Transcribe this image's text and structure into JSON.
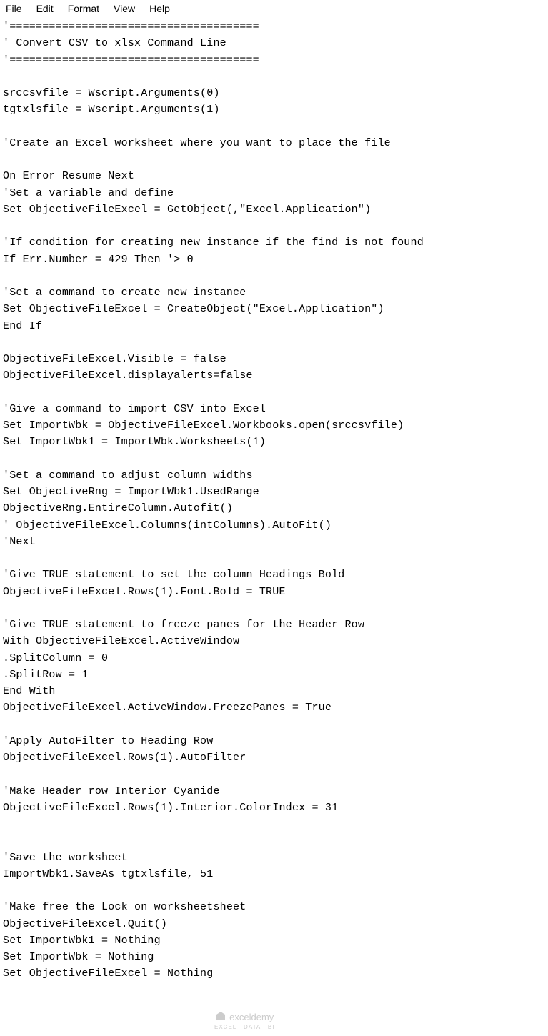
{
  "menu": {
    "file": "File",
    "edit": "Edit",
    "format": "Format",
    "view": "View",
    "help": "Help"
  },
  "code": {
    "l01": "'======================================",
    "l02": "' Convert CSV to xlsx Command Line",
    "l03": "'======================================",
    "l04": "",
    "l05": "srccsvfile = Wscript.Arguments(0)",
    "l06": "tgtxlsfile = Wscript.Arguments(1)",
    "l07": "",
    "l08": "'Create an Excel worksheet where you want to place the file",
    "l09": "",
    "l10": "On Error Resume Next",
    "l11": "'Set a variable and define",
    "l12": "Set ObjectiveFileExcel = GetObject(,\"Excel.Application\")",
    "l13": "",
    "l14": "'If condition for creating new instance if the find is not found",
    "l15": "If Err.Number = 429 Then '> 0",
    "l16": "",
    "l17": "'Set a command to create new instance",
    "l18": "Set ObjectiveFileExcel = CreateObject(\"Excel.Application\")",
    "l19": "End If",
    "l20": "",
    "l21": "ObjectiveFileExcel.Visible = false",
    "l22": "ObjectiveFileExcel.displayalerts=false",
    "l23": "",
    "l24": "'Give a command to import CSV into Excel",
    "l25": "Set ImportWbk = ObjectiveFileExcel.Workbooks.open(srccsvfile)",
    "l26": "Set ImportWbk1 = ImportWbk.Worksheets(1)",
    "l27": "",
    "l28": "'Set a command to adjust column widths",
    "l29": "Set ObjectiveRng = ImportWbk1.UsedRange",
    "l30": "ObjectiveRng.EntireColumn.Autofit()",
    "l31": "' ObjectiveFileExcel.Columns(intColumns).AutoFit()",
    "l32": "'Next",
    "l33": "",
    "l34": "'Give TRUE statement to set the column Headings Bold",
    "l35": "ObjectiveFileExcel.Rows(1).Font.Bold = TRUE",
    "l36": "",
    "l37": "'Give TRUE statement to freeze panes for the Header Row",
    "l38": "With ObjectiveFileExcel.ActiveWindow",
    "l39": ".SplitColumn = 0",
    "l40": ".SplitRow = 1",
    "l41": "End With",
    "l42": "ObjectiveFileExcel.ActiveWindow.FreezePanes = True",
    "l43": "",
    "l44": "'Apply AutoFilter to Heading Row",
    "l45": "ObjectiveFileExcel.Rows(1).AutoFilter",
    "l46": "",
    "l47": "'Make Header row Interior Cyanide",
    "l48": "ObjectiveFileExcel.Rows(1).Interior.ColorIndex = 31",
    "l49": "",
    "l50": "",
    "l51": "'Save the worksheet",
    "l52": "ImportWbk1.SaveAs tgtxlsfile, 51",
    "l53": "",
    "l54": "'Make free the Lock on worksheetsheet",
    "l55": "ObjectiveFileExcel.Quit()",
    "l56": "Set ImportWbk1 = Nothing",
    "l57": "Set ImportWbk = Nothing",
    "l58": "Set ObjectiveFileExcel = Nothing"
  },
  "watermark": {
    "text": "exceldemy",
    "sub": "EXCEL · DATA · BI"
  }
}
